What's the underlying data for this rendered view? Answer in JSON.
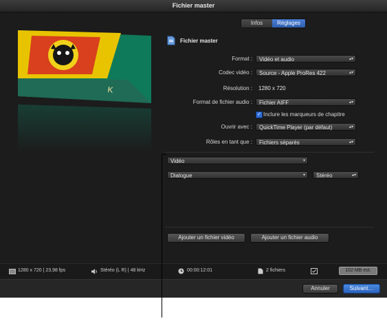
{
  "window": {
    "title": "Fichier master"
  },
  "tabs": [
    {
      "label": "Infos"
    },
    {
      "label": "Réglages"
    }
  ],
  "header": {
    "title": "Fichier master"
  },
  "settings": {
    "format": {
      "label": "Format :",
      "value": "Vidéo et audio"
    },
    "codec": {
      "label": "Codec vidéo :",
      "value": "Source - Apple ProRes 422"
    },
    "resolution": {
      "label": "Résolution :",
      "value": "1280 x 720"
    },
    "audio_format": {
      "label": "Format de fichier audio :",
      "value": "Fichier AIFF"
    },
    "chapters": {
      "label": "Inclure les marqueurs de chapitre",
      "checked": true
    },
    "open_with": {
      "label": "Ouvrir avec :",
      "value": "QuickTime Player (par défaut)"
    },
    "roles": {
      "label": "Rôles en tant que :",
      "value": "Fichiers séparés"
    }
  },
  "roles": {
    "video": "Vidéo",
    "audio": "Dialogue",
    "channel": "Stéréo"
  },
  "buttons": {
    "add_video": "Ajouter un fichier vidéo",
    "add_audio": "Ajouter un fichier audio",
    "cancel": "Annuler",
    "next": "Suivant…"
  },
  "status": {
    "video_info": "1280 x 720 | 23,98 fps",
    "audio_info": "Stéréo (L R) | 48 kHz",
    "duration": "00:00:12:01",
    "files": "2 fichiers",
    "size": "102 MB est."
  },
  "colors": {
    "accent": "#2f5fae",
    "background": "#1c1c1c"
  }
}
